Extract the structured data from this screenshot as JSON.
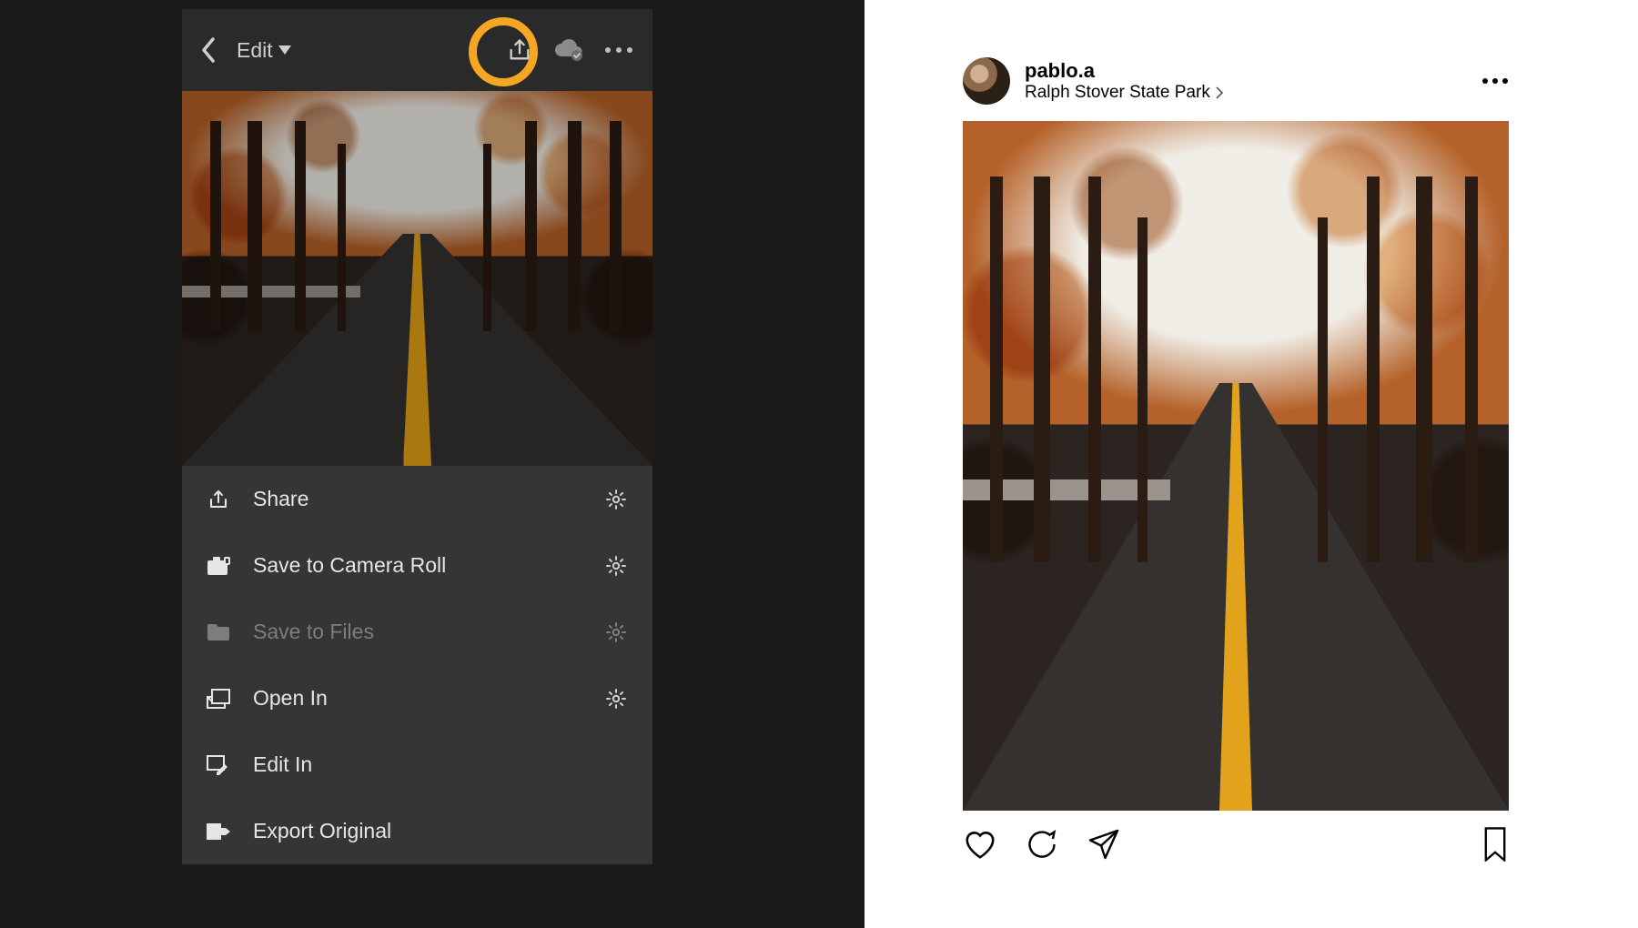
{
  "lightroom": {
    "header": {
      "mode": "Edit"
    },
    "menu": [
      {
        "icon": "share-icon",
        "label": "Share",
        "gear": true,
        "enabled": true
      },
      {
        "icon": "camera-icon",
        "label": "Save to Camera Roll",
        "gear": true,
        "enabled": true
      },
      {
        "icon": "folder-icon",
        "label": "Save to Files",
        "gear": true,
        "enabled": false
      },
      {
        "icon": "open-in-icon",
        "label": "Open In",
        "gear": true,
        "enabled": true
      },
      {
        "icon": "edit-in-icon",
        "label": "Edit In",
        "gear": false,
        "enabled": true
      },
      {
        "icon": "export-icon",
        "label": "Export Original",
        "gear": false,
        "enabled": true
      }
    ]
  },
  "instagram": {
    "username": "pablo.a",
    "location": "Ralph Stover State Park"
  }
}
